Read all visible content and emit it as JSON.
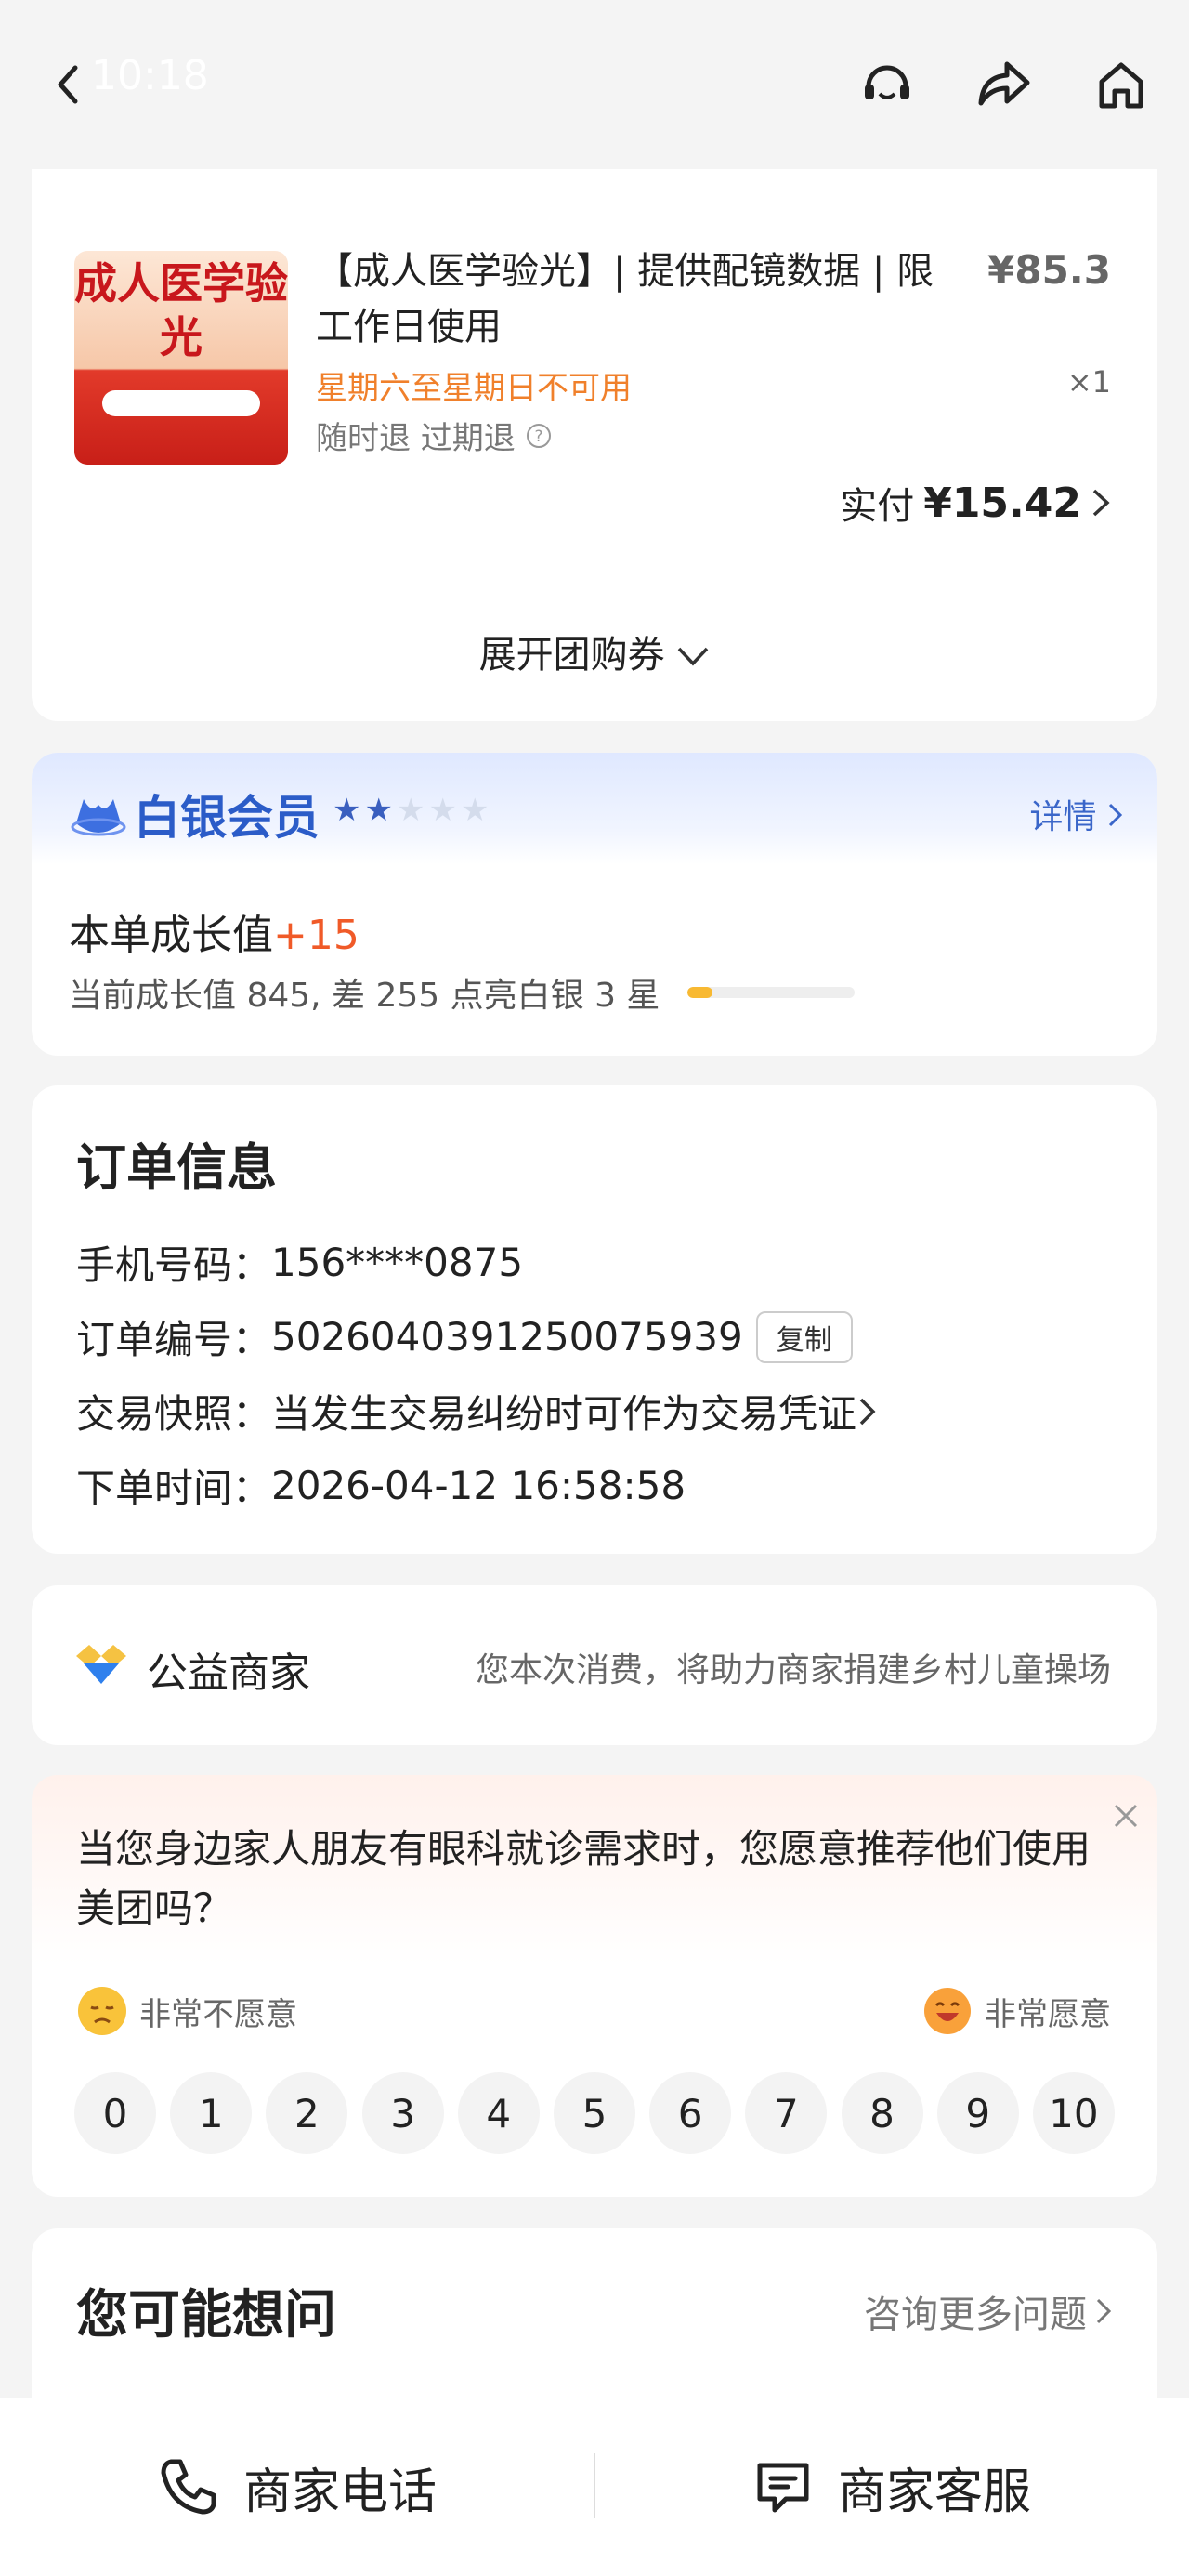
{
  "status": {
    "time": "10:18"
  },
  "nav": {
    "back": "back-icon",
    "service": "headset-icon",
    "share": "share-icon",
    "home": "home-icon"
  },
  "product": {
    "title": "【成人医学验光】| 提供配镜数据 | 限工作日使用",
    "price": "¥85.3",
    "qty": "×1",
    "unavailable": "星期六至星期日不可用",
    "refund": "随时退 过期退",
    "paid_label": "实付",
    "paid_amount": "¥15.42",
    "expand": "展开团购券",
    "image_text": "成人医学验光"
  },
  "member": {
    "level": "白银会员",
    "stars_total": 5,
    "stars_lit": 2,
    "detail": "详情",
    "growth_label": "本单成长值",
    "growth_plus": "+15",
    "growth_desc": "当前成长值 845, 差 255 点亮白银 3 星",
    "progress": 0.15
  },
  "order": {
    "title": "订单信息",
    "phone_label": "手机号码：",
    "phone": "156****0875",
    "no_label": "订单编号：",
    "no": "5026040391250075939",
    "copy": "复制",
    "snapshot_label": "交易快照：",
    "snapshot": "当发生交易纠纷时可作为交易凭证",
    "time_label": "下单时间：",
    "time": "2026-04-12 16:58:58"
  },
  "charity": {
    "label": "公益商家",
    "text": "您本次消费，将助力商家捐建乡村儿童操场"
  },
  "survey": {
    "question": "当您身边家人朋友有眼科就诊需求时，您愿意推荐他们使用美团吗？",
    "low": "非常不愿意",
    "high": "非常愿意",
    "scores": [
      "0",
      "1",
      "2",
      "3",
      "4",
      "5",
      "6",
      "7",
      "8",
      "9",
      "10"
    ]
  },
  "faq": {
    "title": "您可能想问",
    "more": "咨询更多问题"
  },
  "bottom": {
    "phone": "商家电话",
    "service": "商家客服"
  },
  "colors": {
    "orange": "#f0802b",
    "blue": "#2b5cc8",
    "red": "#f05a28"
  }
}
